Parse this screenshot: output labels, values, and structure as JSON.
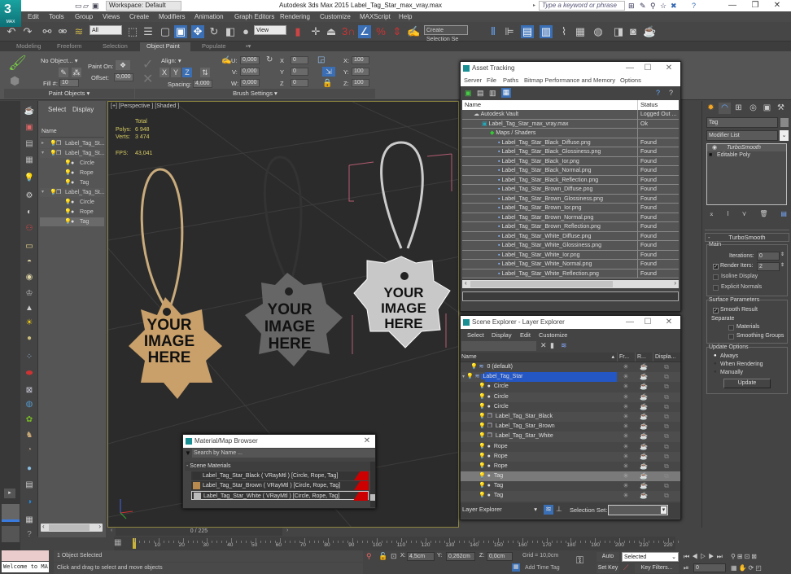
{
  "titlebar": {
    "logo_label": "MAX",
    "workspace": "Workspace: Default",
    "title": "Autodesk 3ds Max  2015    Label_Tag_Star_max_vray.max",
    "search_placeholder": "Type a keyword or phrase",
    "minimize": "—",
    "restore": "❐",
    "close": "✕"
  },
  "menu": [
    "Edit",
    "Tools",
    "Group",
    "Views",
    "Create",
    "Modifiers",
    "Animation",
    "Graph Editors",
    "Rendering",
    "Customize",
    "MAXScript",
    "Help"
  ],
  "toolbar": {
    "selection_filter": "All",
    "ref_coord": "View",
    "snap_label": "3",
    "named_selection": "Create Selection Se"
  },
  "ribbon": {
    "tabs": [
      "Modeling",
      "Freeform",
      "Selection",
      "Object Paint",
      "Populate"
    ],
    "active_tab": "Object Paint",
    "no_object": "No Object...",
    "paint_on_label": "Paint On:",
    "offset_label": "Offset:",
    "offset_value": "0,000",
    "fill_label": "Fill #:",
    "fill_value": "10",
    "align_label": "Align:",
    "axis_x": "X",
    "axis_y": "Y",
    "axis_z": "Z",
    "spacing_label": "Spacing:",
    "spacing_value": "4,000",
    "u_label": "U:",
    "u_value": "0,000",
    "v_label": "V:",
    "v_value": "0,000",
    "w_label": "W:",
    "w_value": "0,000",
    "rx_label": "X",
    "rx_value": "0",
    "ry_label": "Y",
    "ry_value": "0",
    "rz_label": "Z",
    "rz_value": "0",
    "sx_label": "X:",
    "sx_value": "100",
    "sy_label": "Y:",
    "sy_value": "100",
    "sz_label": "Z:",
    "sz_value": "100",
    "group_paint_objects": "Paint Objects",
    "group_brush_settings": "Brush Settings"
  },
  "scene_explorer": {
    "menu": [
      "Select",
      "Display"
    ],
    "column_name": "Name",
    "rows": [
      {
        "label": "Label_Tag_St...",
        "type": "group",
        "expanded": false
      },
      {
        "label": "Label_Tag_St...",
        "type": "group",
        "expanded": true
      },
      {
        "label": "Circle",
        "type": "object"
      },
      {
        "label": "Rope",
        "type": "object"
      },
      {
        "label": "Tag",
        "type": "object"
      },
      {
        "label": "Label_Tag_St...",
        "type": "group",
        "expanded": true
      },
      {
        "label": "Circle",
        "type": "object"
      },
      {
        "label": "Rope",
        "type": "object"
      },
      {
        "label": "Tag",
        "type": "object",
        "selected": true
      }
    ]
  },
  "viewport": {
    "label": "[+] [Perspective ] [Shaded ]",
    "stats_total": "Total",
    "polys_label": "Polys:",
    "polys_value": "6 948",
    "verts_label": "Verts:",
    "verts_value": "3 474",
    "fps_label": "FPS:",
    "fps_value": "43,041",
    "tag_text": [
      "YOUR",
      "IMAGE",
      "HERE"
    ]
  },
  "asset_tracking": {
    "title": "Asset Tracking",
    "menu": [
      "Server",
      "File",
      "Paths",
      "Bitmap Performance and Memory",
      "Options"
    ],
    "col_name": "Name",
    "col_status": "Status",
    "rows": [
      {
        "name": "Autodesk Vault",
        "status": "Logged Out ...",
        "level": 1
      },
      {
        "name": "Label_Tag_Star_max_vray.max",
        "status": "Ok",
        "level": 2
      },
      {
        "name": "Maps / Shaders",
        "status": "",
        "level": 3
      },
      {
        "name": "Label_Tag_Star_Black_Diffuse.png",
        "status": "Found",
        "level": 4
      },
      {
        "name": "Label_Tag_Star_Black_Glossiness.png",
        "status": "Found",
        "level": 4
      },
      {
        "name": "Label_Tag_Star_Black_Ior.png",
        "status": "Found",
        "level": 4
      },
      {
        "name": "Label_Tag_Star_Black_Normal.png",
        "status": "Found",
        "level": 4
      },
      {
        "name": "Label_Tag_Star_Black_Reflection.png",
        "status": "Found",
        "level": 4
      },
      {
        "name": "Label_Tag_Star_Brown_Diffuse.png",
        "status": "Found",
        "level": 4
      },
      {
        "name": "Label_Tag_Star_Brown_Glossiness.png",
        "status": "Found",
        "level": 4
      },
      {
        "name": "Label_Tag_Star_Brown_Ior.png",
        "status": "Found",
        "level": 4
      },
      {
        "name": "Label_Tag_Star_Brown_Normal.png",
        "status": "Found",
        "level": 4
      },
      {
        "name": "Label_Tag_Star_Brown_Reflection.png",
        "status": "Found",
        "level": 4
      },
      {
        "name": "Label_Tag_Star_White_Diffuse.png",
        "status": "Found",
        "level": 4
      },
      {
        "name": "Label_Tag_Star_White_Glossiness.png",
        "status": "Found",
        "level": 4
      },
      {
        "name": "Label_Tag_Star_White_Ior.png",
        "status": "Found",
        "level": 4
      },
      {
        "name": "Label_Tag_Star_White_Normal.png",
        "status": "Found",
        "level": 4
      },
      {
        "name": "Label_Tag_Star_White_Reflection.png",
        "status": "Found",
        "level": 4
      }
    ]
  },
  "layer_explorer": {
    "title": "Scene Explorer - Layer Explorer",
    "menu": [
      "Select",
      "Display",
      "Edit",
      "Customize"
    ],
    "col_name": "Name",
    "col_freeze": "Fr...",
    "col_render": "R...",
    "col_display": "Displa...",
    "rows": [
      {
        "name": "0 (default)",
        "kind": "layer",
        "indent": 1
      },
      {
        "name": "Label_Tag_Star",
        "kind": "layer",
        "indent": 0,
        "highlight": true
      },
      {
        "name": "Circle",
        "kind": "object",
        "indent": 2
      },
      {
        "name": "Circle",
        "kind": "object",
        "indent": 2
      },
      {
        "name": "Circle",
        "kind": "object",
        "indent": 2
      },
      {
        "name": "Label_Tag_Star_Black",
        "kind": "group",
        "indent": 2
      },
      {
        "name": "Label_Tag_Star_Brown",
        "kind": "group",
        "indent": 2
      },
      {
        "name": "Label_Tag_Star_White",
        "kind": "group",
        "indent": 2
      },
      {
        "name": "Rope",
        "kind": "object",
        "indent": 2
      },
      {
        "name": "Rope",
        "kind": "object",
        "indent": 2
      },
      {
        "name": "Rope",
        "kind": "object",
        "indent": 2
      },
      {
        "name": "Tag",
        "kind": "object",
        "indent": 2,
        "selected": true
      },
      {
        "name": "Tag",
        "kind": "object",
        "indent": 2
      },
      {
        "name": "Tag",
        "kind": "object",
        "indent": 2
      }
    ],
    "footer_mode": "Layer Explorer",
    "selection_set_label": "Selection Set:"
  },
  "material_browser": {
    "title": "Material/Map Browser",
    "search_placeholder": "Search by Name ...",
    "section": "- Scene Materials",
    "items": [
      {
        "label": "Label_Tag_Star_Black  ( VRayMtl ) [Circle, Rope, Tag]",
        "swatch": "#333333"
      },
      {
        "label": "Label_Tag_Star_Brown  ( VRayMtl ) [Circle, Rope, Tag]",
        "swatch": "#b98a4e"
      },
      {
        "label": "Label_Tag_Star_White  ( VRayMtl ) [Circle, Rope, Tag]",
        "swatch": "#bbbbbb"
      }
    ]
  },
  "command_panel": {
    "object_name": "Tag",
    "modifier_list": "Modifier List",
    "stack": [
      "TurboSmooth",
      "Editable Poly"
    ],
    "rollout_title": "TurboSmooth",
    "main_label": "Main",
    "iterations_label": "Iterations:",
    "iterations_value": "0",
    "render_iters_label": "Render Iters:",
    "render_iters_value": "2",
    "render_iters_checked": true,
    "isoline_label": "Isoline Display",
    "explicit_normals_label": "Explicit Normals",
    "surface_label": "Surface Parameters",
    "smooth_result_label": "Smooth Result",
    "separate_label": "Separate",
    "materials_label": "Materials",
    "smoothing_groups_label": "Smoothing Groups",
    "update_options_label": "Update Options",
    "always_label": "Always",
    "when_rendering_label": "When Rendering",
    "manually_label": "Manually",
    "update_button": "Update"
  },
  "timeline": {
    "frame_display": "0 / 225",
    "ticks": [
      "10",
      "20",
      "30",
      "40",
      "50",
      "60",
      "70",
      "80",
      "90",
      "100",
      "110",
      "120",
      "130",
      "140",
      "150",
      "160",
      "170",
      "180",
      "190",
      "200",
      "210",
      "220"
    ]
  },
  "status": {
    "maxscript": "Welcome to MA",
    "selected": "1 Object Selected",
    "prompt": "Click and drag to select and move objects",
    "x_label": "X:",
    "x_value": "4,5cm",
    "y_label": "Y:",
    "y_value": "0,262cm",
    "z_label": "Z:",
    "z_value": "0,0cm",
    "grid": "Grid = 10,0cm",
    "add_time_tag": "Add Time Tag",
    "auto_key": "Auto Key",
    "set_key": "Set Key",
    "key_mode": "Selected",
    "key_filters": "Key Filters...",
    "current_frame": "0"
  }
}
